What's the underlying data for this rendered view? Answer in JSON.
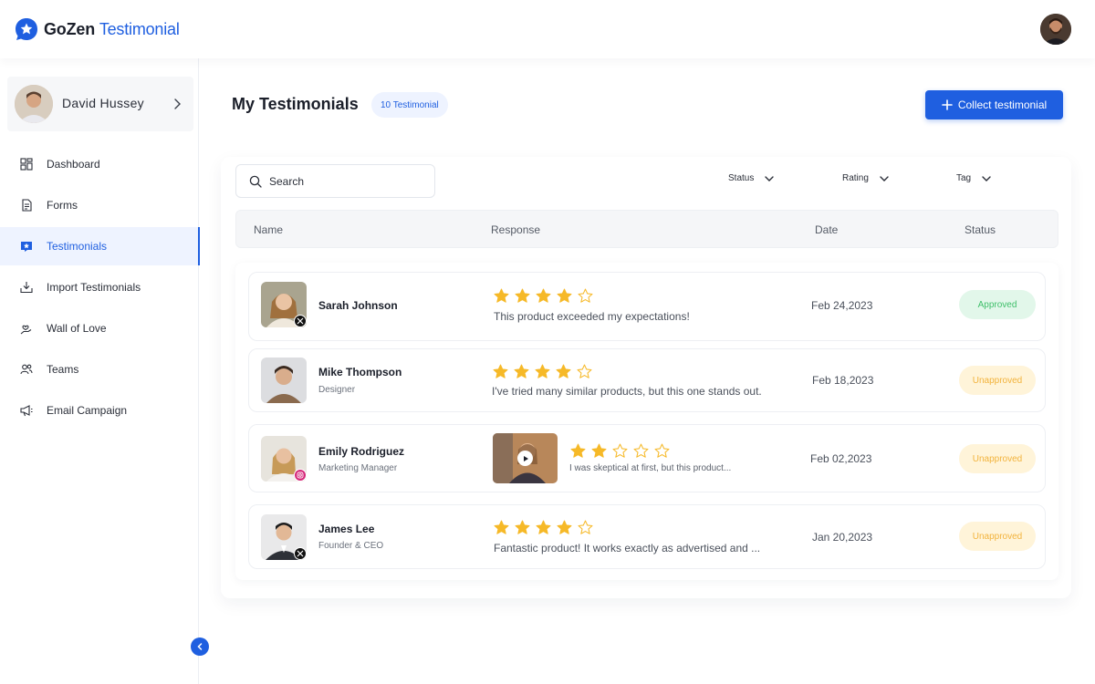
{
  "brand": {
    "name": "GoZen",
    "product": "Testimonial",
    "accent": "#1f5fe0"
  },
  "user": {
    "name": "David Hussey"
  },
  "sidebar": {
    "items": [
      {
        "label": "Dashboard",
        "icon": "dashboard-icon",
        "active": false
      },
      {
        "label": "Forms",
        "icon": "form-icon",
        "active": false
      },
      {
        "label": "Testimonials",
        "icon": "testimonial-icon",
        "active": true
      },
      {
        "label": "Import Testimonials",
        "icon": "import-icon",
        "active": false
      },
      {
        "label": "Wall of Love",
        "icon": "hand-heart-icon",
        "active": false
      },
      {
        "label": "Teams",
        "icon": "team-icon",
        "active": false
      },
      {
        "label": "Email Campaign",
        "icon": "megaphone-icon",
        "active": false
      }
    ]
  },
  "page": {
    "title": "My Testimonials",
    "count_label": "10 Testimonial",
    "collect_button": "Collect testimonial"
  },
  "filters": {
    "search_placeholder": "Search",
    "status": "Status",
    "rating": "Rating",
    "tag": "Tag"
  },
  "table": {
    "headers": {
      "name": "Name",
      "response": "Response",
      "date": "Date",
      "status": "Status"
    },
    "rows": [
      {
        "name": "Sarah Johnson",
        "role": "",
        "social": "x-icon",
        "rating": 4,
        "text": "This product exceeded my expectations!",
        "date": "Feb 24,2023",
        "status": "Approved",
        "has_video": false
      },
      {
        "name": "Mike Thompson",
        "role": "Designer",
        "social": "",
        "rating": 4,
        "text": "I've tried many similar products, but this one stands out.",
        "date": "Feb 18,2023",
        "status": "Unapproved",
        "has_video": false
      },
      {
        "name": "Emily Rodriguez",
        "role": "Marketing Manager",
        "social": "instagram-icon",
        "rating": 2,
        "text": "I was skeptical at first, but this product...",
        "date": "Feb 02,2023",
        "status": "Unapproved",
        "has_video": true
      },
      {
        "name": "James Lee",
        "role": "Founder & CEO",
        "social": "x-icon",
        "rating": 4,
        "text": "Fantastic product! It works exactly as advertised and ...",
        "date": "Jan 20,2023",
        "status": "Unapproved",
        "has_video": false
      }
    ]
  },
  "colors": {
    "star": "#f6b928",
    "approved": "#3fbf6a",
    "unapproved": "#f2b33d"
  }
}
